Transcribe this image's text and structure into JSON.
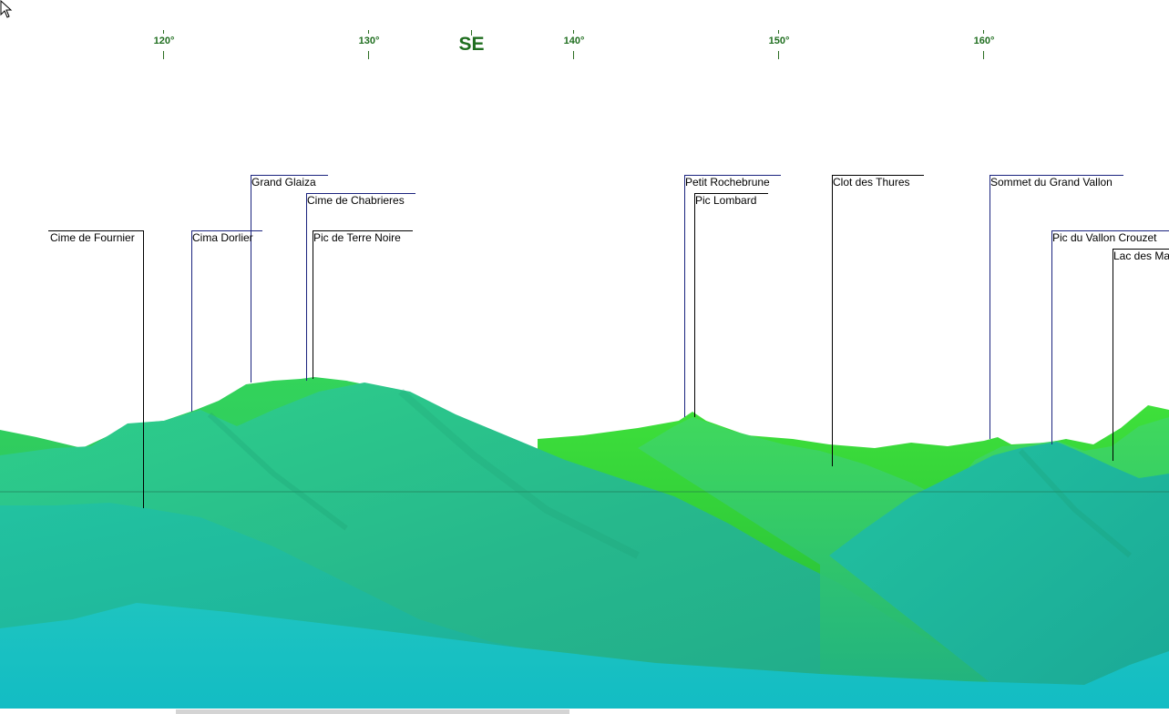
{
  "compass": {
    "degree_ticks": [
      {
        "deg": 120,
        "label": "120°"
      },
      {
        "deg": 130,
        "label": "130°"
      },
      {
        "deg": 140,
        "label": "140°"
      },
      {
        "deg": 150,
        "label": "150°"
      },
      {
        "deg": 160,
        "label": "160°"
      }
    ],
    "cardinal": {
      "deg": 135,
      "label": "SE"
    },
    "label_color": "#1f6e1f"
  },
  "peaks": [
    {
      "name": "Cime de Fournier",
      "line_color": "#000000"
    },
    {
      "name": "Cima Dorlier",
      "line_color": "#1a237e"
    },
    {
      "name": "Grand Glaiza",
      "line_color": "#1a237e"
    },
    {
      "name": "Cime de Chabrieres",
      "line_color": "#1a237e"
    },
    {
      "name": "Pic de Terre Noire",
      "line_color": "#000000"
    },
    {
      "name": "Petit Rochebrune",
      "line_color": "#1a237e"
    },
    {
      "name": "Pic Lombard",
      "line_color": "#000000"
    },
    {
      "name": "Clot des Thures",
      "line_color": "#000000"
    },
    {
      "name": "Sommet du Grand Vallon",
      "line_color": "#1a237e"
    },
    {
      "name": "Pic du Vallon Crouzet",
      "line_color": "#1a237e"
    },
    {
      "name": "Lac des Ma",
      "line_color": "#000000"
    }
  ],
  "colors": {
    "sky": "#ffffff",
    "far_ridge": "#2ed42e",
    "mid_ridge": "#25c47a",
    "near_slope": "#20b89a",
    "foreground": "#18c0c0"
  }
}
